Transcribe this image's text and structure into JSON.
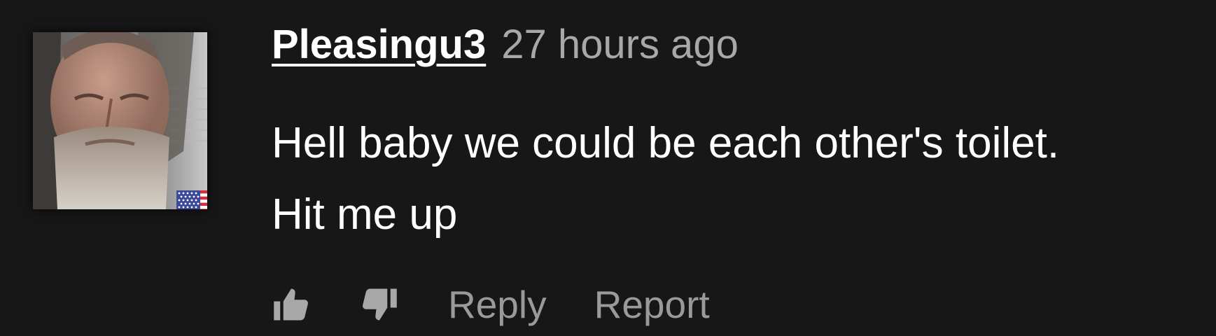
{
  "comment": {
    "username": "Pleasingu3",
    "timestamp": "27 hours ago",
    "text_line_1": "Hell baby we could be each other's toilet.",
    "text_line_2": "Hit me up",
    "avatar_alt": "user avatar",
    "country_flag": "us-flag-icon"
  },
  "actions": {
    "reply_label": "Reply",
    "report_label": "Report",
    "like_icon": "thumbs-up-icon",
    "dislike_icon": "thumbs-down-icon"
  },
  "colors": {
    "background": "#171717",
    "username": "#ffffff",
    "timestamp": "#a8a8a8",
    "text": "#ffffff",
    "actions": "#9a9a9a"
  }
}
